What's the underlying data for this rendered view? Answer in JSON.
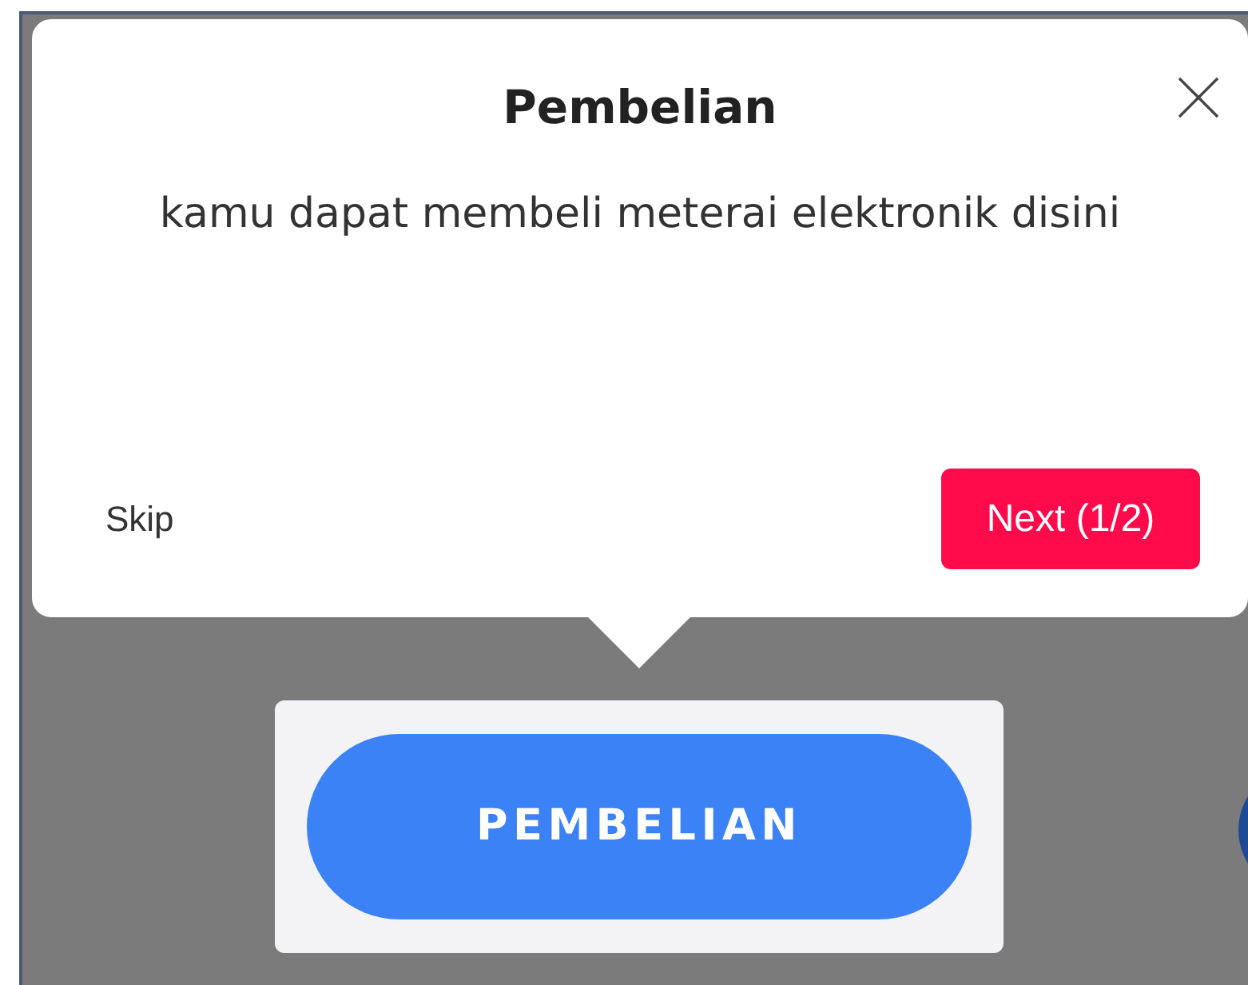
{
  "tour_popup": {
    "title": "Pembelian",
    "message": "kamu dapat membeli meterai elektronik disini",
    "skip_label": "Skip",
    "next_label": "Next (1/2)"
  },
  "highlighted_button": {
    "label": "PEMBELIAN"
  }
}
